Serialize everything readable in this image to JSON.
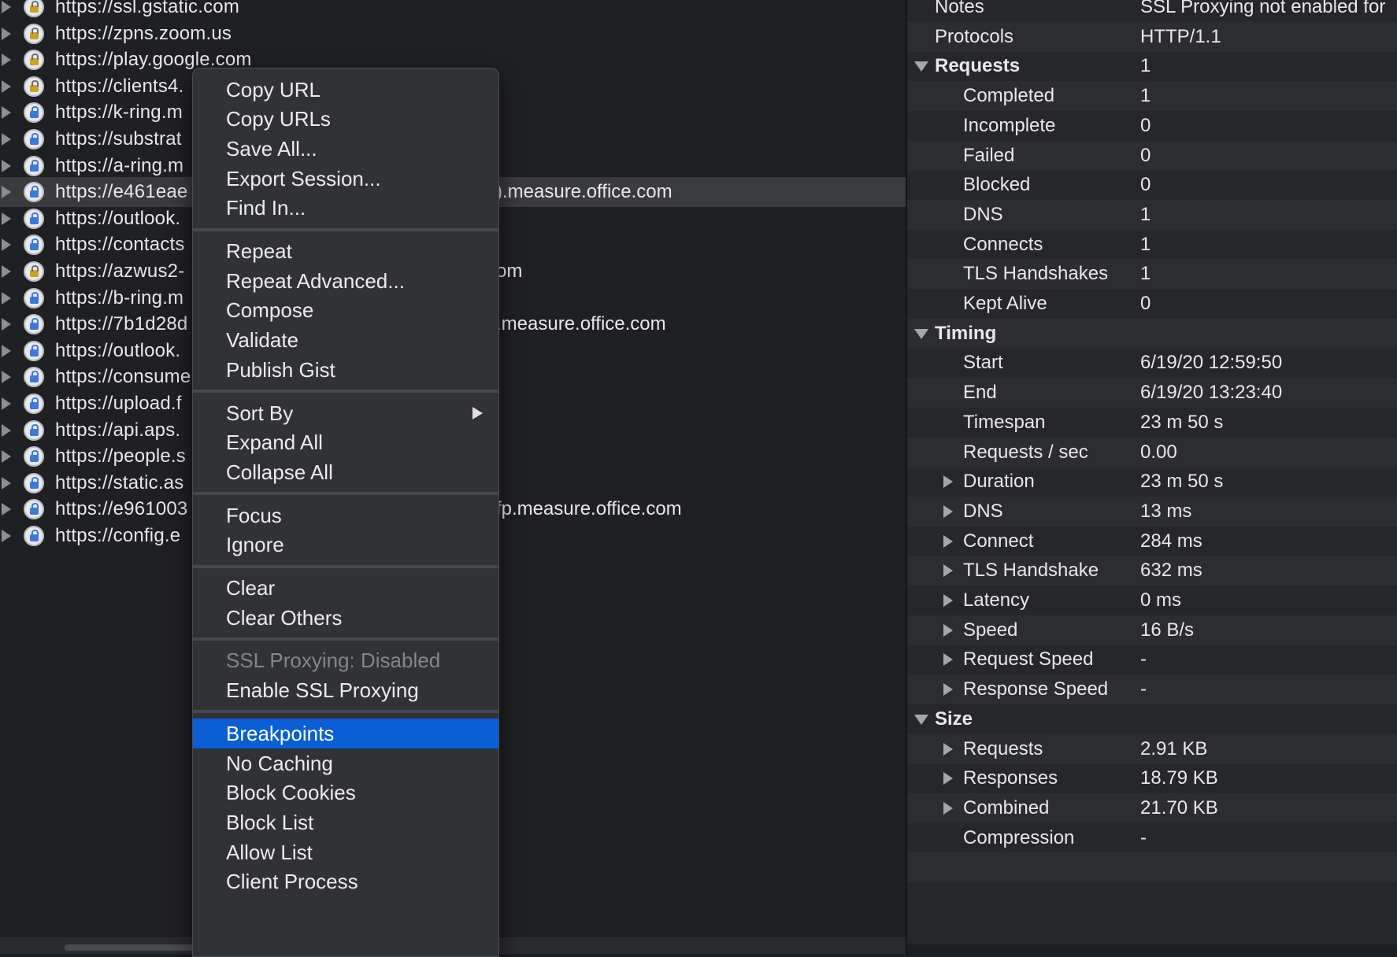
{
  "hosts": [
    {
      "prefix": "https://ssl.gstatic.com",
      "icon": "warn",
      "suffix": ""
    },
    {
      "prefix": "https://zpns.zoom.us",
      "icon": "warn",
      "suffix": ""
    },
    {
      "prefix": "https://play.google.com",
      "icon": "warn",
      "suffix": ""
    },
    {
      "prefix": "https://clients4.",
      "icon": "warn",
      "suffix": ""
    },
    {
      "prefix": "https://k-ring.m",
      "icon": "bolt",
      "suffix": ""
    },
    {
      "prefix": "https://substrat",
      "icon": "bolt",
      "suffix": ""
    },
    {
      "prefix": "https://a-ring.m",
      "icon": "bolt",
      "suffix": ""
    },
    {
      "prefix": "https://e461eae",
      "icon": "bolt",
      "suffix": ").measure.office.com"
    },
    {
      "prefix": "https://outlook.",
      "icon": "bolt",
      "suffix": ""
    },
    {
      "prefix": "https://contacts",
      "icon": "bolt",
      "suffix": ""
    },
    {
      "prefix": "https://azwus2-",
      "icon": "warn",
      "suffix": "om"
    },
    {
      "prefix": "https://b-ring.m",
      "icon": "bolt",
      "suffix": ""
    },
    {
      "prefix": "https://7b1d28d",
      "icon": "bolt",
      "suffix": ".measure.office.com"
    },
    {
      "prefix": "https://outlook.",
      "icon": "bolt",
      "suffix": ""
    },
    {
      "prefix": "https://consume",
      "icon": "bolt",
      "suffix": ""
    },
    {
      "prefix": "https://upload.f",
      "icon": "bolt",
      "suffix": ""
    },
    {
      "prefix": "https://api.aps.",
      "icon": "bolt",
      "suffix": ""
    },
    {
      "prefix": "https://people.s",
      "icon": "bolt",
      "suffix": ""
    },
    {
      "prefix": "https://static.as",
      "icon": "bolt",
      "suffix": ""
    },
    {
      "prefix": "https://e961003",
      "icon": "bolt",
      "suffix": "fp.measure.office.com"
    },
    {
      "prefix": "https://config.e",
      "icon": "bolt",
      "suffix": ""
    }
  ],
  "selected_host_index": 7,
  "overview": [
    {
      "key": "Notes",
      "value": "SSL Proxying not enabled for",
      "level": 0,
      "type": "plain"
    },
    {
      "key": "Protocols",
      "value": "HTTP/1.1",
      "level": 0,
      "type": "plain"
    },
    {
      "key": "Requests",
      "value": "1",
      "level": 0,
      "type": "section"
    },
    {
      "key": "Completed",
      "value": "1",
      "level": 1,
      "type": "plain"
    },
    {
      "key": "Incomplete",
      "value": "0",
      "level": 1,
      "type": "plain"
    },
    {
      "key": "Failed",
      "value": "0",
      "level": 1,
      "type": "plain"
    },
    {
      "key": "Blocked",
      "value": "0",
      "level": 1,
      "type": "plain"
    },
    {
      "key": "DNS",
      "value": "1",
      "level": 1,
      "type": "plain"
    },
    {
      "key": "Connects",
      "value": "1",
      "level": 1,
      "type": "plain"
    },
    {
      "key": "TLS Handshakes",
      "value": "1",
      "level": 1,
      "type": "plain"
    },
    {
      "key": "Kept Alive",
      "value": "0",
      "level": 1,
      "type": "plain"
    },
    {
      "key": "Timing",
      "value": "",
      "level": 0,
      "type": "section"
    },
    {
      "key": "Start",
      "value": "6/19/20 12:59:50",
      "level": 1,
      "type": "plain"
    },
    {
      "key": "End",
      "value": "6/19/20 13:23:40",
      "level": 1,
      "type": "plain"
    },
    {
      "key": "Timespan",
      "value": "23 m 50 s",
      "level": 1,
      "type": "plain"
    },
    {
      "key": "Requests / sec",
      "value": "0.00",
      "level": 1,
      "type": "plain"
    },
    {
      "key": "Duration",
      "value": "23 m 50 s",
      "level": 1,
      "type": "expandable"
    },
    {
      "key": "DNS",
      "value": "13 ms",
      "level": 1,
      "type": "expandable"
    },
    {
      "key": "Connect",
      "value": "284 ms",
      "level": 1,
      "type": "expandable"
    },
    {
      "key": "TLS Handshake",
      "value": "632 ms",
      "level": 1,
      "type": "expandable"
    },
    {
      "key": "Latency",
      "value": "0 ms",
      "level": 1,
      "type": "expandable"
    },
    {
      "key": "Speed",
      "value": "16 B/s",
      "level": 1,
      "type": "expandable"
    },
    {
      "key": "Request Speed",
      "value": "-",
      "level": 1,
      "type": "expandable"
    },
    {
      "key": "Response Speed",
      "value": "-",
      "level": 1,
      "type": "expandable"
    },
    {
      "key": "Size",
      "value": "",
      "level": 0,
      "type": "section"
    },
    {
      "key": "Requests",
      "value": "2.91 KB",
      "level": 1,
      "type": "expandable"
    },
    {
      "key": "Responses",
      "value": "18.79 KB",
      "level": 1,
      "type": "expandable"
    },
    {
      "key": "Combined",
      "value": "21.70 KB",
      "level": 1,
      "type": "expandable"
    },
    {
      "key": "Compression",
      "value": "-",
      "level": 1,
      "type": "plain"
    },
    {
      "key": "",
      "value": "",
      "level": 1,
      "type": "plain"
    },
    {
      "key": "",
      "value": "",
      "level": 1,
      "type": "plain"
    }
  ],
  "context_menu": {
    "groups": [
      [
        {
          "label": "Copy URL"
        },
        {
          "label": "Copy URLs"
        },
        {
          "label": "Save All..."
        },
        {
          "label": "Export Session..."
        },
        {
          "label": "Find In..."
        }
      ],
      [
        {
          "label": "Repeat"
        },
        {
          "label": "Repeat Advanced..."
        },
        {
          "label": "Compose"
        },
        {
          "label": "Validate"
        },
        {
          "label": "Publish Gist"
        }
      ],
      [
        {
          "label": "Sort By",
          "submenu": true
        },
        {
          "label": "Expand All"
        },
        {
          "label": "Collapse All"
        }
      ],
      [
        {
          "label": "Focus"
        },
        {
          "label": "Ignore"
        }
      ],
      [
        {
          "label": "Clear"
        },
        {
          "label": "Clear Others"
        }
      ],
      [
        {
          "label": "SSL Proxying: Disabled",
          "disabled": true
        },
        {
          "label": "Enable SSL Proxying"
        }
      ],
      [
        {
          "label": "Breakpoints",
          "highlighted": true
        },
        {
          "label": "No Caching"
        },
        {
          "label": "Block Cookies"
        },
        {
          "label": "Block List"
        },
        {
          "label": "Allow List"
        },
        {
          "label": "Client Process"
        }
      ]
    ]
  },
  "colors": {
    "highlight": "#0a5fd6",
    "menu_bg": "#303236",
    "selected_row": "#3a3b3e"
  }
}
